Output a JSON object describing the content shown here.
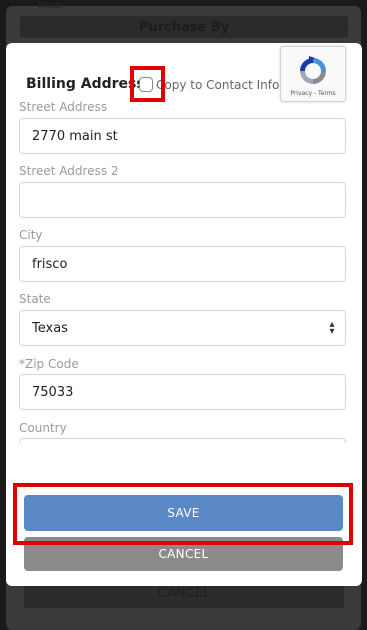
{
  "background": {
    "header_title": "Purchase By",
    "top_text": "Note",
    "bottom_button": "CANCEL"
  },
  "billing": {
    "title": "Billing Address",
    "copy_label": "Copy to Contact Info"
  },
  "recaptcha": {
    "text": "Privacy - Terms"
  },
  "fields": {
    "street": {
      "label": "Street Address",
      "value": "2770 main st"
    },
    "street2": {
      "label": "Street Address 2",
      "value": ""
    },
    "city": {
      "label": "City",
      "value": "frisco"
    },
    "state": {
      "label": "State",
      "value": "Texas"
    },
    "zip": {
      "label": "*Zip Code",
      "value": "75033"
    },
    "country": {
      "label": "Country",
      "value": ""
    }
  },
  "buttons": {
    "save": "SAVE",
    "cancel": "CANCEL"
  },
  "colors": {
    "save": "#5b88c6",
    "cancel": "#8b8b8b",
    "highlight": "#e00000"
  }
}
